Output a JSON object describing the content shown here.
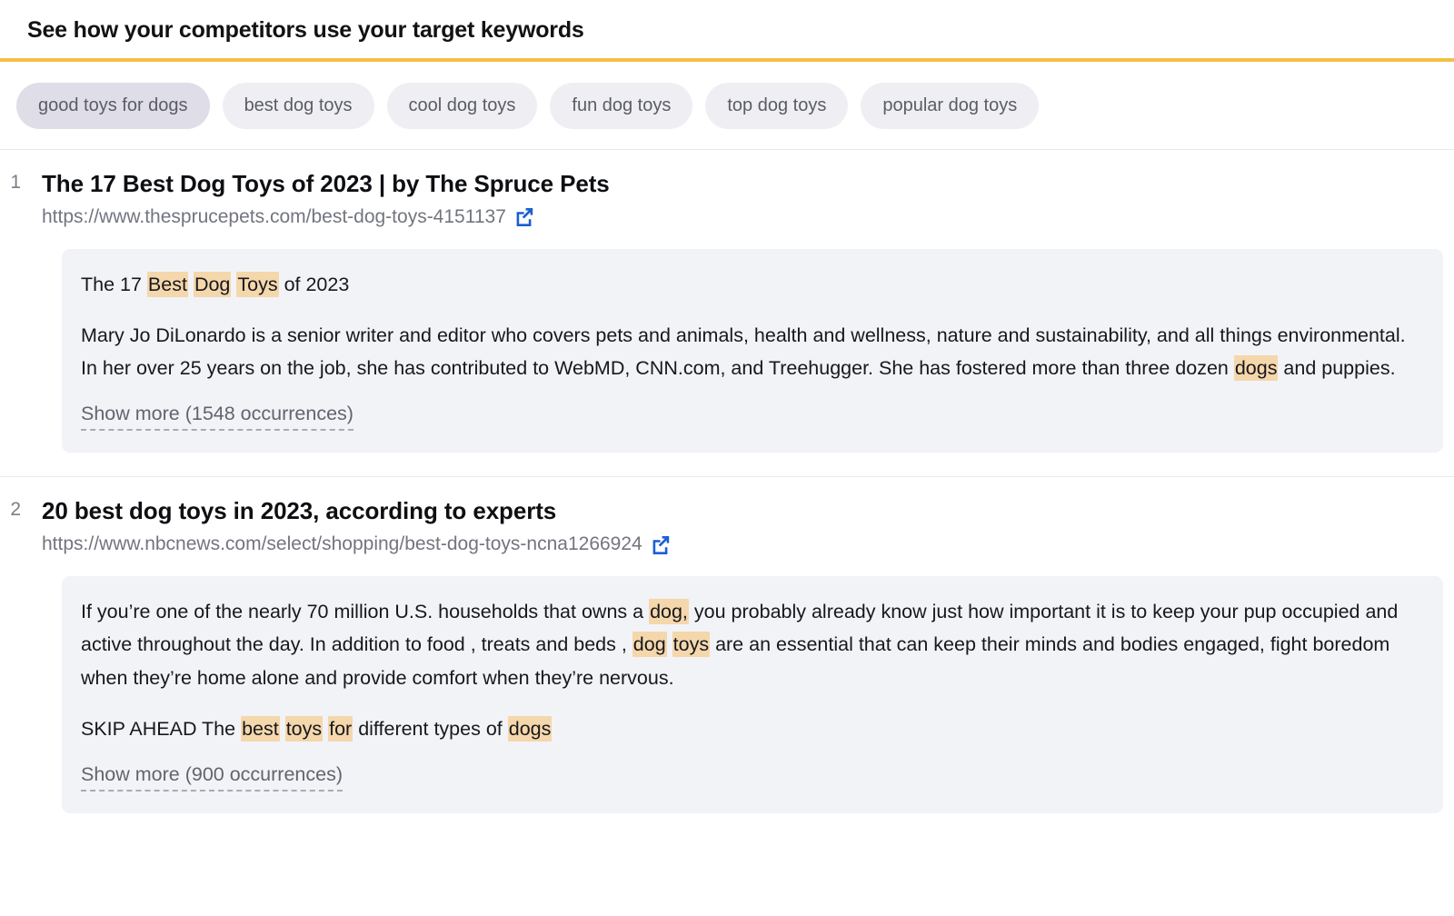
{
  "header": {
    "title": "See how your competitors use your target keywords",
    "accent_color": "#F5BF42"
  },
  "keyword_pills": {
    "items": [
      {
        "label": "good toys for dogs",
        "selected": true
      },
      {
        "label": "best dog toys",
        "selected": false
      },
      {
        "label": "cool dog toys",
        "selected": false
      },
      {
        "label": "fun dog toys",
        "selected": false
      },
      {
        "label": "top dog toys",
        "selected": false
      },
      {
        "label": "popular dog toys",
        "selected": false
      }
    ],
    "selected_background": "#DEDDE8",
    "background": "#EFEFF3"
  },
  "results": [
    {
      "rank": "1",
      "title": "The 17 Best Dog Toys of 2023 | by The Spruce Pets",
      "url": "https://www.thesprucepets.com/best-dog-toys-4151137",
      "external_link_icon": "external-link-icon",
      "paragraphs": [
        [
          {
            "text": "The 17 ",
            "highlight": false
          },
          {
            "text": "Best",
            "highlight": true
          },
          {
            "text": " ",
            "highlight": false
          },
          {
            "text": "Dog",
            "highlight": true
          },
          {
            "text": " ",
            "highlight": false
          },
          {
            "text": "Toys",
            "highlight": true
          },
          {
            "text": " of 2023",
            "highlight": false
          }
        ],
        [
          {
            "text": "Mary Jo DiLonardo is a senior writer and editor who covers pets and animals, health and wellness, nature and sustainability, and all things environmental. In her over 25 years on the job, she has contributed to WebMD, CNN.com, and Treehugger. She has fostered more than three dozen ",
            "highlight": false
          },
          {
            "text": "dogs",
            "highlight": true
          },
          {
            "text": " and puppies.",
            "highlight": false
          }
        ]
      ],
      "show_more": "Show more (1548 occurrences)"
    },
    {
      "rank": "2",
      "title": "20 best dog toys in 2023, according to experts",
      "url": "https://www.nbcnews.com/select/shopping/best-dog-toys-ncna1266924",
      "external_link_icon": "external-link-icon",
      "paragraphs": [
        [
          {
            "text": "If you’re one of the nearly 70 million U.S. households that owns a ",
            "highlight": false
          },
          {
            "text": "dog,",
            "highlight": true
          },
          {
            "text": " you probably already know just how important it is to keep your pup occupied and active throughout the day. In addition to food , treats and beds , ",
            "highlight": false
          },
          {
            "text": "dog",
            "highlight": true
          },
          {
            "text": " ",
            "highlight": false
          },
          {
            "text": "toys",
            "highlight": true
          },
          {
            "text": " are an essential that can keep their minds and bodies engaged, fight boredom when they’re home alone and provide comfort when they’re nervous.",
            "highlight": false
          }
        ],
        [
          {
            "text": "SKIP AHEAD The ",
            "highlight": false
          },
          {
            "text": "best",
            "highlight": true
          },
          {
            "text": " ",
            "highlight": false
          },
          {
            "text": "toys",
            "highlight": true
          },
          {
            "text": " ",
            "highlight": false
          },
          {
            "text": "for",
            "highlight": true
          },
          {
            "text": " different types of ",
            "highlight": false
          },
          {
            "text": "dogs",
            "highlight": true
          }
        ]
      ],
      "show_more": "Show more (900 occurrences)"
    }
  ],
  "colors": {
    "highlight": "#F5D7AC",
    "snippet_background": "#F2F3F7",
    "divider": "#E9E9EE",
    "link_icon": "#1A5FD0"
  }
}
